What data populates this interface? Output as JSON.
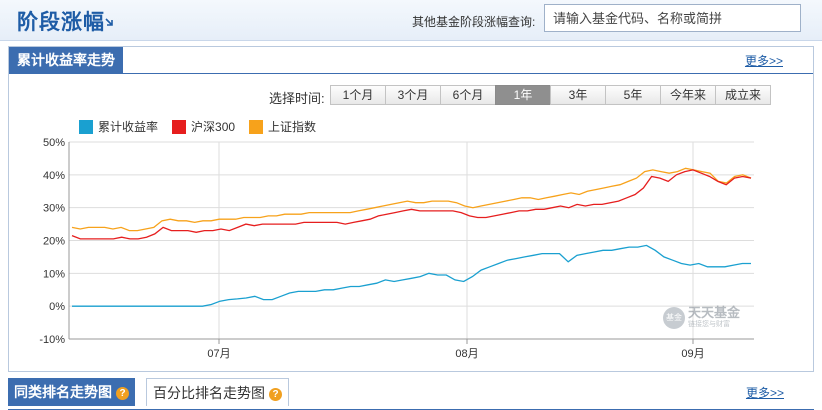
{
  "header": {
    "title": "阶段涨幅",
    "search_label": "其他基金阶段涨幅查询:",
    "search_placeholder": "请输入基金代码、名称或简拼"
  },
  "panel": {
    "tab_label": "累计收益率走势",
    "more_label": "更多>>",
    "range_label": "选择时间:",
    "ranges": [
      "1个月",
      "3个月",
      "6个月",
      "1年",
      "3年",
      "5年",
      "今年来",
      "成立来"
    ],
    "active_range": "1年"
  },
  "watermark": {
    "badge": "基金",
    "text": "天天基金",
    "sub": "链接您与财富"
  },
  "bottom": {
    "tab1_label": "同类排名走势图",
    "tab2_label": "百分比排名走势图",
    "more_label": "更多>>"
  },
  "colors": {
    "accent": "#3c6db0",
    "series1": "#1aa0d0",
    "series2": "#e61e1e",
    "series3": "#f7a21b"
  },
  "chart_data": {
    "type": "line",
    "ylim": [
      -10,
      50
    ],
    "yticks": [
      "50%",
      "40%",
      "30%",
      "20%",
      "10%",
      "0%",
      "-10%"
    ],
    "xticks": [
      "07月",
      "08月",
      "09月"
    ],
    "legend_position": "top-left",
    "grid": true,
    "series": [
      {
        "name": "累计收益率",
        "values": [
          0,
          0,
          0,
          0,
          0,
          0,
          0,
          0,
          0,
          0,
          0,
          0,
          0,
          0,
          0,
          0,
          0.5,
          1.5,
          2,
          2.2,
          2.5,
          3,
          2,
          2,
          3,
          4,
          4.5,
          4.5,
          4.5,
          5,
          5,
          5.5,
          6,
          6,
          6.5,
          7,
          8,
          7.5,
          8,
          8.5,
          9,
          10,
          9.5,
          9.5,
          8,
          7.5,
          9,
          11,
          12,
          13,
          14,
          14.5,
          15,
          15.5,
          16,
          16,
          16,
          13.5,
          15.5,
          16,
          16.5,
          17,
          17,
          17.5,
          18,
          18,
          18.5,
          17,
          15,
          14,
          13,
          12.5,
          13,
          12,
          12,
          12,
          12.5,
          13,
          13
        ]
      },
      {
        "name": "沪深300",
        "values": [
          21.5,
          20.5,
          20.5,
          20.5,
          20.5,
          20.5,
          21,
          20.5,
          20.5,
          21,
          22,
          24,
          23,
          23,
          23,
          22.5,
          23,
          23,
          23.5,
          23,
          24,
          25,
          24.5,
          25,
          25,
          25,
          25,
          25,
          25.5,
          25.5,
          25.5,
          25.5,
          25.5,
          25,
          25.5,
          26,
          26.5,
          27.5,
          28,
          28.5,
          29,
          29.5,
          29,
          29,
          29,
          29,
          29,
          28.5,
          27.5,
          27,
          27,
          27.5,
          28,
          28.5,
          29,
          29,
          29.5,
          29.5,
          30,
          30.5,
          30,
          31,
          30.5,
          31,
          31,
          31.5,
          32,
          33,
          34,
          36,
          39.5,
          39,
          38,
          40,
          41,
          41.5,
          40.5,
          39.5,
          38,
          37,
          39,
          39.5,
          39
        ]
      },
      {
        "name": "上证指数",
        "values": [
          24,
          23.5,
          24,
          24,
          24,
          23.5,
          24,
          23,
          23,
          23.5,
          24,
          26,
          26.5,
          26,
          26,
          25.5,
          26,
          26,
          26.5,
          26.5,
          26.5,
          27,
          27,
          27,
          27.5,
          27.5,
          28,
          28,
          28,
          28.5,
          28.5,
          28.5,
          28.5,
          28.5,
          28.5,
          29,
          29.5,
          30,
          30.5,
          31,
          31.5,
          32,
          31.5,
          31.5,
          32,
          32,
          32,
          31.5,
          30.5,
          30,
          30.5,
          31,
          31.5,
          32,
          32.5,
          33,
          33,
          32.5,
          33,
          33.5,
          34,
          34.5,
          34,
          35,
          35.5,
          36,
          36.5,
          37,
          38,
          39,
          41,
          41.5,
          41,
          40.5,
          41,
          42,
          41.5,
          41,
          40.5,
          38,
          37.5,
          39.5,
          40,
          39
        ]
      }
    ]
  }
}
